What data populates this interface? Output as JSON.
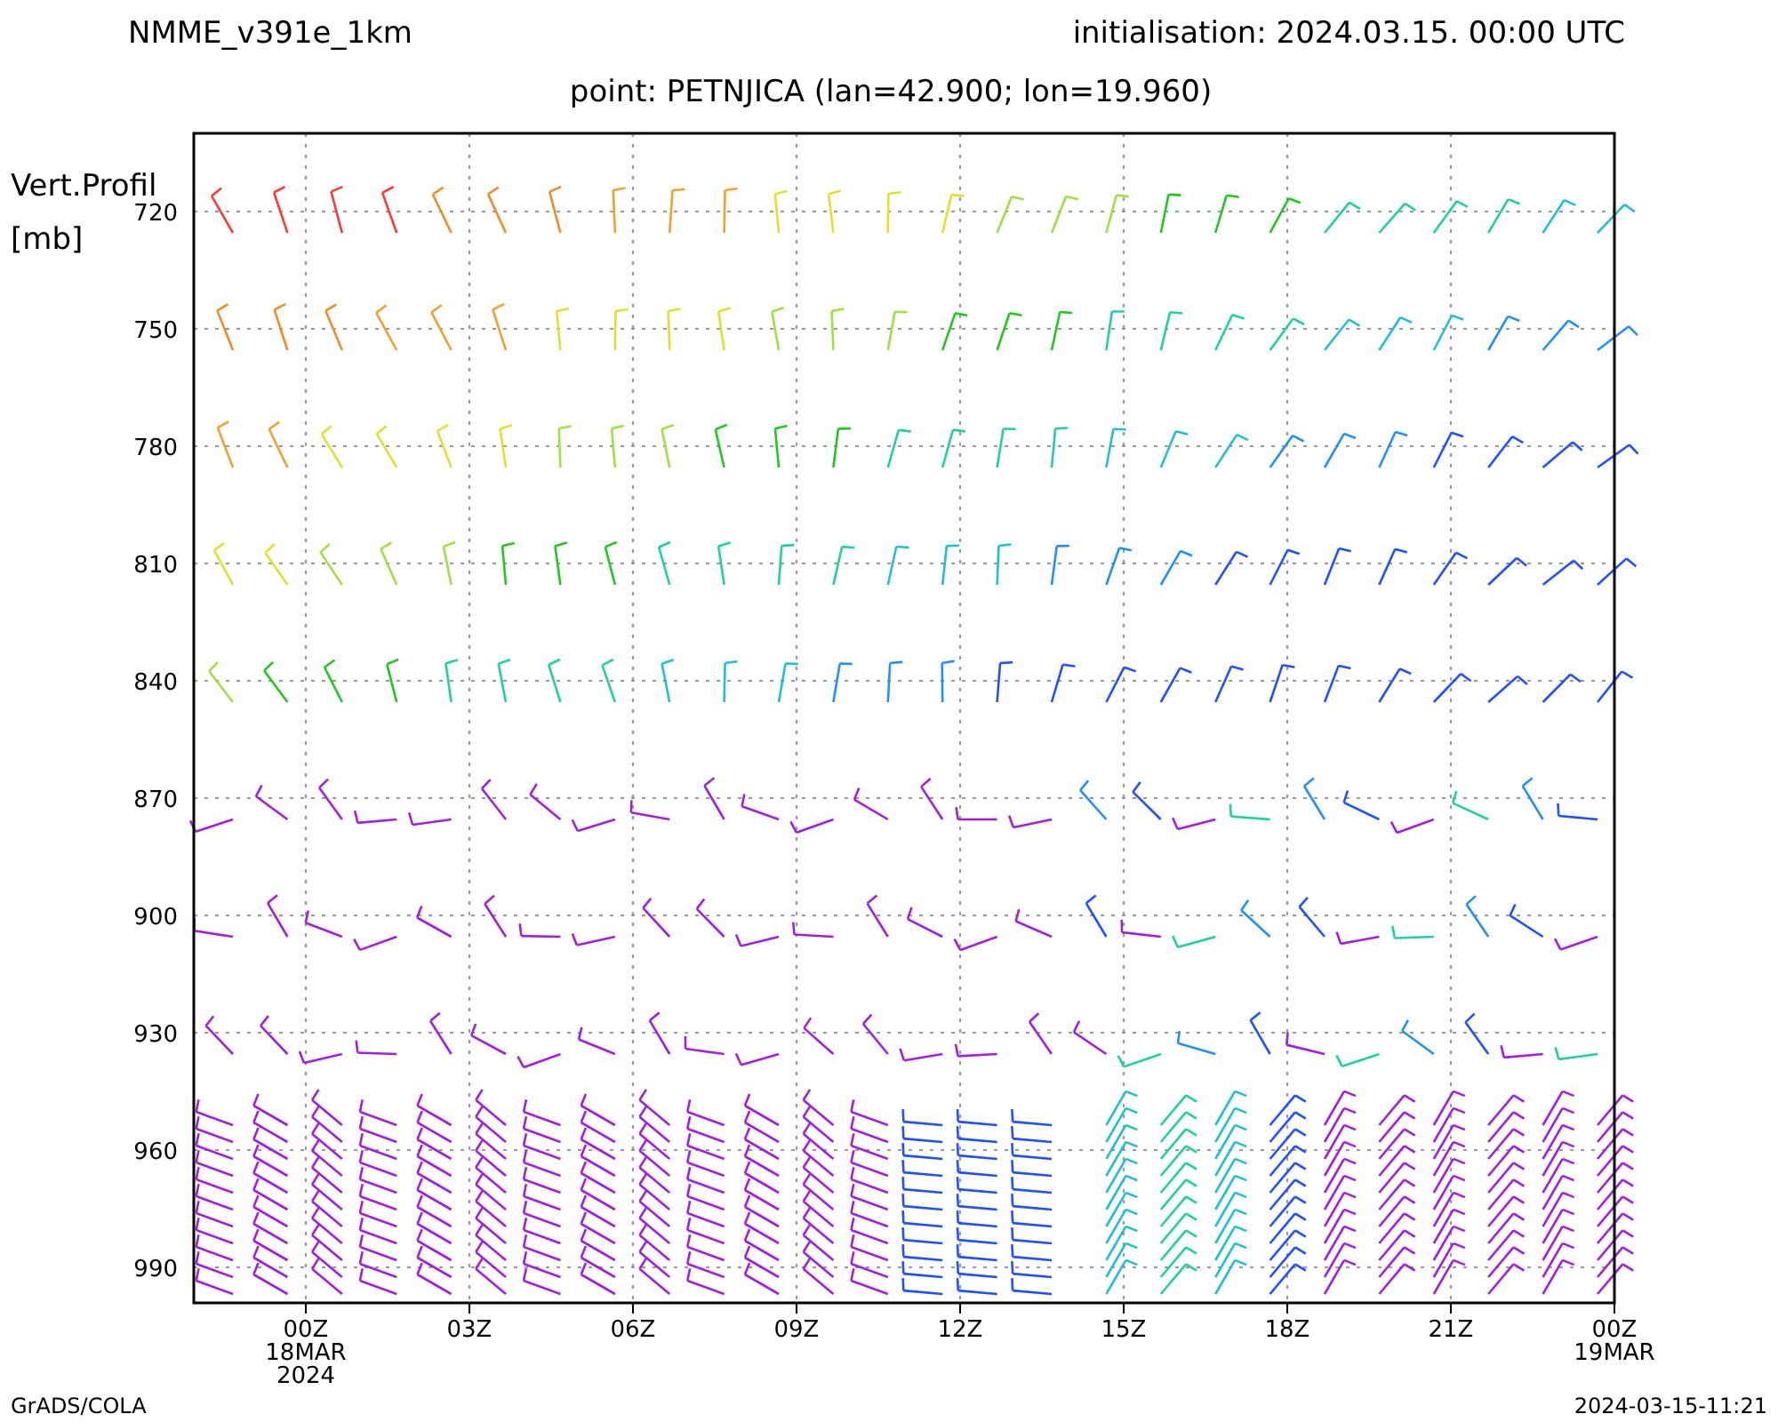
{
  "header": {
    "model": "NMME_v391e_1km",
    "initialisation": "initialisation: 2024.03.15. 00:00 UTC"
  },
  "subtitle": "point: PETNJICA (lan=42.900; lon=19.960)",
  "y_axis": {
    "label_lines": [
      "Vert.Profil",
      "[mb]"
    ],
    "ticks": [
      "720",
      "750",
      "780",
      "810",
      "840",
      "870",
      "900",
      "930",
      "960",
      "990"
    ]
  },
  "x_axis": {
    "ticks": [
      {
        "lines": [
          "00Z",
          "18MAR",
          "2024"
        ]
      },
      {
        "lines": [
          "03Z"
        ]
      },
      {
        "lines": [
          "06Z"
        ]
      },
      {
        "lines": [
          "09Z"
        ]
      },
      {
        "lines": [
          "12Z"
        ]
      },
      {
        "lines": [
          "15Z"
        ]
      },
      {
        "lines": [
          "18Z"
        ]
      },
      {
        "lines": [
          "21Z"
        ]
      },
      {
        "lines": [
          "00Z",
          "19MAR"
        ]
      }
    ]
  },
  "footer": {
    "left": "GrADS/COLA",
    "right": "2024-03-15-11:21"
  }
}
